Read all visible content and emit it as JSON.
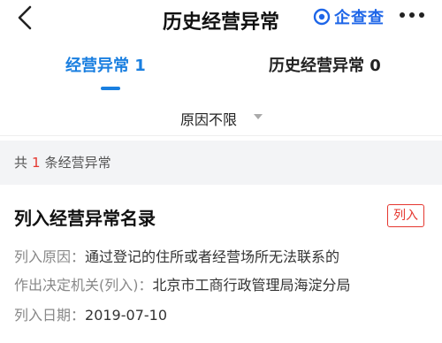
{
  "header": {
    "title": "历史经营异常",
    "brand": "企查查",
    "back_icon": "chevron-left-icon",
    "more_icon": "more-dots-icon"
  },
  "tabs": [
    {
      "label": "经营异常 1",
      "active": true
    },
    {
      "label": "历史经营异常 0",
      "active": false
    }
  ],
  "filter": {
    "label": "原因不限"
  },
  "summary": {
    "prefix": "共",
    "count": "1",
    "suffix": "条经营异常"
  },
  "record": {
    "title": "列入经营异常名录",
    "badge": "列入",
    "reason_label": "列入原因：",
    "reason_value": "通过登记的住所或者经营场所无法联系的",
    "authority_label": "作出决定机关(列入)：",
    "authority_value": "北京市工商行政管理局海淀分局",
    "date_label": "列入日期：",
    "date_value": "2019-07-10"
  },
  "colors": {
    "accent": "#1a7fe0",
    "brand": "#1e66e8",
    "alert": "#e5372f"
  }
}
